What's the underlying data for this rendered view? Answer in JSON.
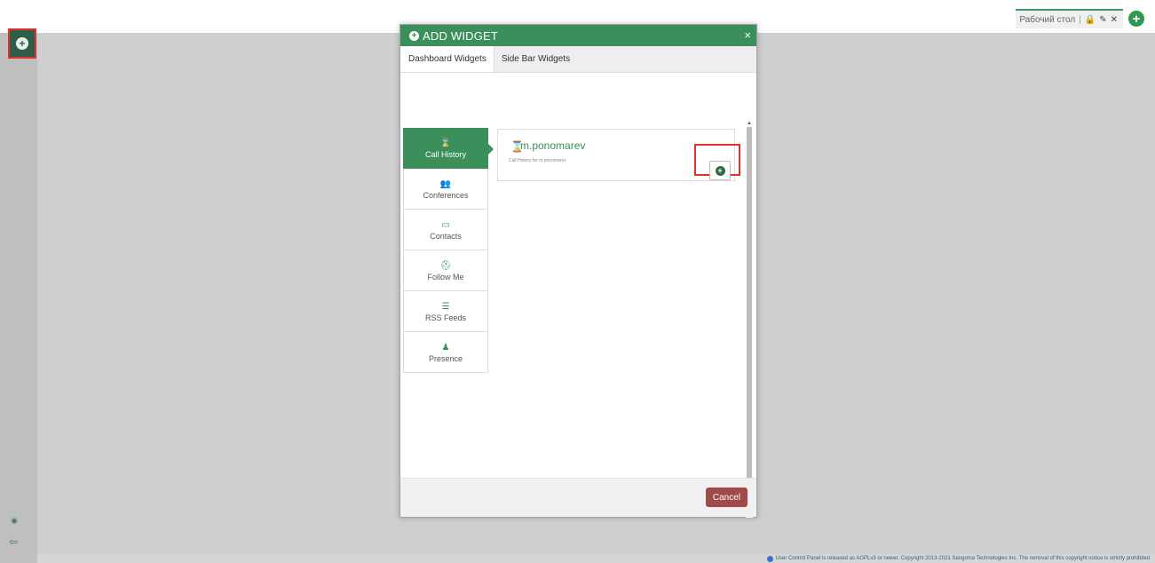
{
  "top_tab": {
    "label": "Рабочий стол"
  },
  "modal": {
    "title": "ADD WIDGET",
    "close_icon_text": "×",
    "tabs": [
      "Dashboard Widgets",
      "Side Bar Widgets"
    ],
    "widget_list": [
      {
        "label": "Call History",
        "icon": "⌛"
      },
      {
        "label": "Conferences",
        "icon": "👥"
      },
      {
        "label": "Contacts",
        "icon": "▭"
      },
      {
        "label": "Follow Me",
        "icon": "⛑"
      },
      {
        "label": "RSS Feeds",
        "icon": "☰"
      },
      {
        "label": "Presence",
        "icon": "♟"
      }
    ],
    "widget_card": {
      "name": "m.ponomarev",
      "description": "Call History for m.ponomarev"
    },
    "cancel_label": "Cancel"
  },
  "footer": {
    "copyright": "User Control Panel is released as AGPLv3 or newer. Copyright 2013-2021 Sangoma Technologies Inc. The removal of this copyright notice is strictly prohibited"
  }
}
